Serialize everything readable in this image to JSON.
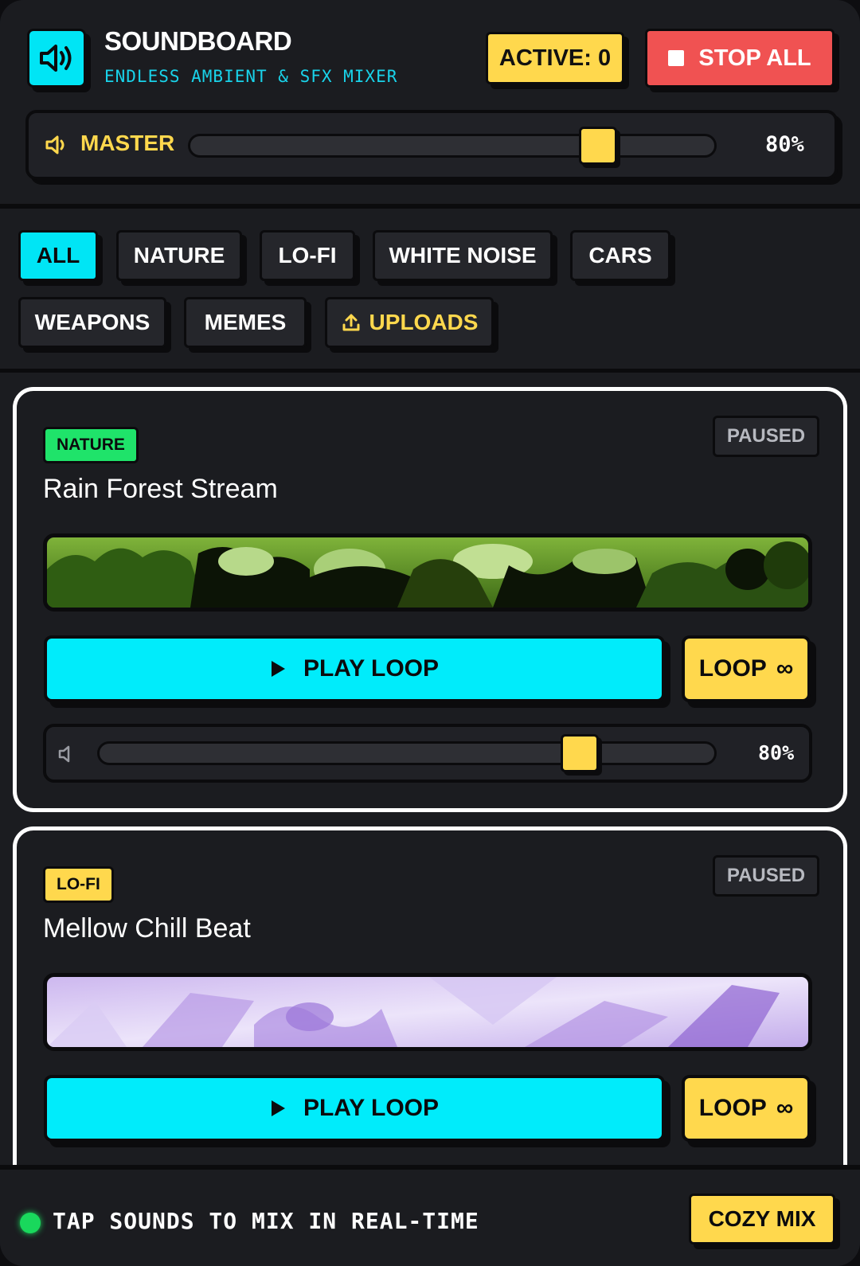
{
  "header": {
    "title": "SOUNDBOARD",
    "subtitle": "ENDLESS AMBIENT & SFX MIXER",
    "active_label": "ACTIVE: 0",
    "stop_all_label": "STOP ALL",
    "logo_icon": "speaker-waves-icon"
  },
  "master": {
    "label": "MASTER",
    "volume_percent": 80,
    "volume_text": "80%",
    "icon": "speaker-icon"
  },
  "filters": {
    "items": [
      {
        "label": "ALL",
        "active": true
      },
      {
        "label": "NATURE",
        "active": false
      },
      {
        "label": "LO-FI",
        "active": false
      },
      {
        "label": "WHITE NOISE",
        "active": false
      },
      {
        "label": "CARS",
        "active": false
      },
      {
        "label": "WEAPONS",
        "active": false
      },
      {
        "label": "MEMES",
        "active": false
      },
      {
        "label": "UPLOADS",
        "active": false,
        "icon": "upload-icon"
      }
    ]
  },
  "sounds": [
    {
      "tag": "NATURE",
      "status": "PAUSED",
      "title": "Rain Forest Stream",
      "play_label": "PLAY LOOP",
      "loop_label": "LOOP",
      "loop_symbol": "∞",
      "volume_percent": 80,
      "volume_text": "80%"
    },
    {
      "tag": "LO-FI",
      "status": "PAUSED",
      "title": "Mellow Chill Beat",
      "play_label": "PLAY LOOP",
      "loop_label": "LOOP",
      "loop_symbol": "∞"
    }
  ],
  "footer": {
    "hint": "TAP SOUNDS TO MIX IN REAL-TIME",
    "cozy_label": "COZY MIX"
  },
  "colors": {
    "accent_cyan": "#00e5f5",
    "accent_yellow": "#ffd84d",
    "danger_red": "#f05252",
    "nature_green": "#1fe36a",
    "background": "#1b1c20"
  }
}
